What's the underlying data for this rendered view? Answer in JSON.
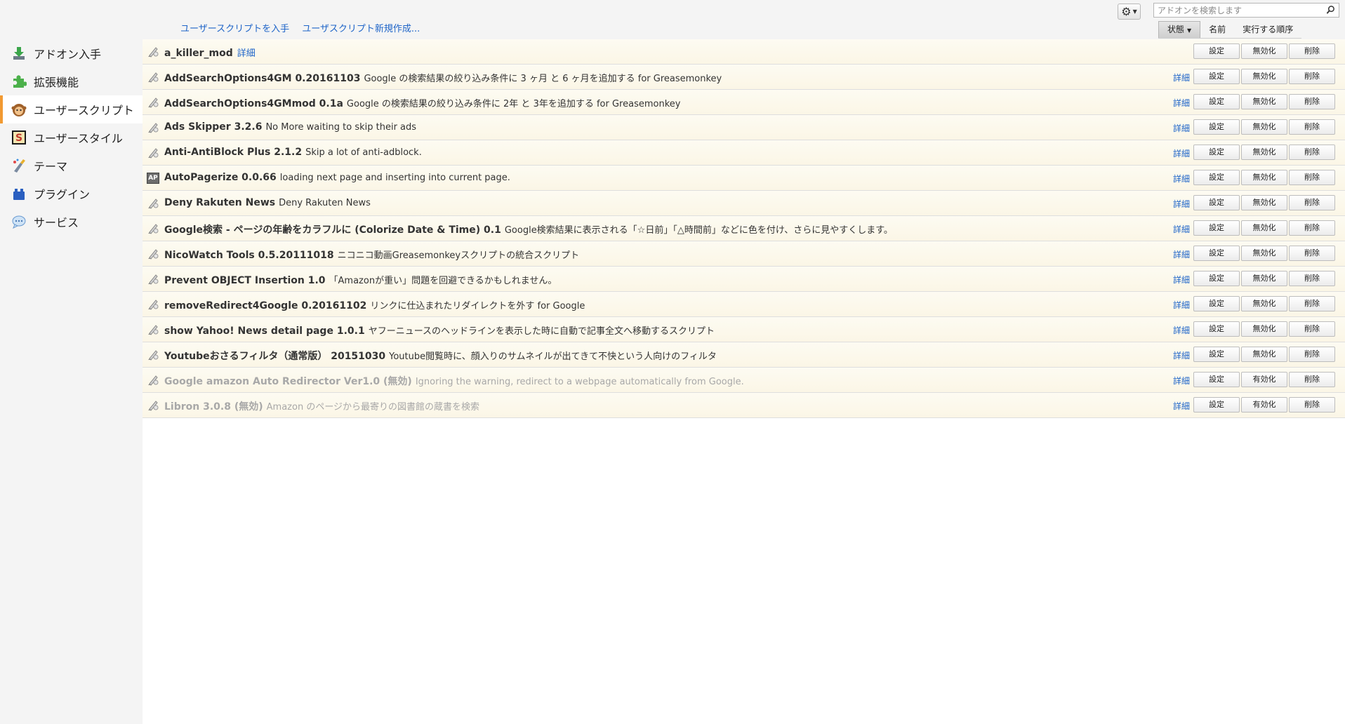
{
  "top_links": [
    "ユーザースクリプトを入手",
    "ユーザスクリプト新規作成..."
  ],
  "search": {
    "placeholder": "アドオンを検索します"
  },
  "sort": {
    "items": [
      "状態",
      "名前",
      "実行する順序"
    ]
  },
  "sidebar": {
    "items": [
      {
        "label": "アドオン入手",
        "icon": "download-icon"
      },
      {
        "label": "拡張機能",
        "icon": "puzzle-icon"
      },
      {
        "label": "ユーザースクリプト",
        "icon": "greasemonkey-icon"
      },
      {
        "label": "ユーザースタイル",
        "icon": "stylish-icon"
      },
      {
        "label": "テーマ",
        "icon": "theme-brush-icon"
      },
      {
        "label": "プラグイン",
        "icon": "plugin-blocks-icon"
      },
      {
        "label": "サービス",
        "icon": "chat-bubble-icon"
      }
    ],
    "selected_index": 2
  },
  "buttons": {
    "settings": "設定",
    "disable": "無効化",
    "enable": "有効化",
    "remove": "削除",
    "detail": "詳細"
  },
  "scripts": [
    {
      "name": "a_killer_mod",
      "description": "",
      "icon": "script-icon",
      "disabled": false
    },
    {
      "name": "AddSearchOptions4GM 0.20161103",
      "description": "Google の検索結果の絞り込み条件に 3 ヶ月 と 6 ヶ月を追加する for Greasemonkey",
      "icon": "script-icon",
      "disabled": false
    },
    {
      "name": "AddSearchOptions4GMmod 0.1a",
      "description": "Google の検索結果の絞り込み条件に 2年 と 3年を追加する for Greasemonkey",
      "icon": "script-icon",
      "disabled": false
    },
    {
      "name": "Ads Skipper 3.2.6",
      "description": "No More waiting to skip their ads",
      "icon": "script-icon",
      "disabled": false
    },
    {
      "name": "Anti-AntiBlock Plus 2.1.2",
      "description": "Skip a lot of anti-adblock.",
      "icon": "script-icon",
      "disabled": false
    },
    {
      "name": "AutoPagerize 0.0.66",
      "description": "loading next page and inserting into current page.",
      "icon": "autopagerize-icon",
      "disabled": false
    },
    {
      "name": "Deny Rakuten News",
      "description": "Deny Rakuten News",
      "icon": "script-icon",
      "disabled": false
    },
    {
      "name": "Google検索 - ページの年齢をカラフルに (Colorize Date & Time) 0.1",
      "description": "Google検索結果に表示される「☆日前」「△時間前」などに色を付け、さらに見やすくします。",
      "icon": "script-icon",
      "disabled": false
    },
    {
      "name": "NicoWatch Tools 0.5.20111018",
      "description": "ニコニコ動画Greasemonkeyスクリプトの統合スクリプト",
      "icon": "script-icon",
      "disabled": false
    },
    {
      "name": "Prevent OBJECT Insertion 1.0",
      "description": "「Amazonが重い」問題を回避できるかもしれません。",
      "icon": "script-icon",
      "disabled": false
    },
    {
      "name": "removeRedirect4Google 0.20161102",
      "description": "リンクに仕込まれたリダイレクトを外す for Google",
      "icon": "script-icon",
      "disabled": false
    },
    {
      "name": "show Yahoo! News detail page 1.0.1",
      "description": "ヤフーニュースのヘッドラインを表示した時に自動で記事全文へ移動するスクリプト",
      "icon": "script-icon",
      "disabled": false
    },
    {
      "name": "Youtubeおさるフィルタ（通常版） 20151030",
      "description": "Youtube閲覧時に、顔入りのサムネイルが出てきて不快という人向けのフィルタ",
      "icon": "script-icon",
      "disabled": false
    },
    {
      "name": "Google amazon Auto Redirector Ver1.0 (無効)",
      "description": "Ignoring the warning, redirect to a webpage automatically from Google.",
      "icon": "script-icon",
      "disabled": true
    },
    {
      "name": "Libron 3.0.8 (無効)",
      "description": "Amazon のページから最寄りの図書館の蔵書を検索",
      "icon": "script-icon",
      "disabled": true
    }
  ],
  "colors": {
    "link": "#1e64c8",
    "accent_selected": "#f29a32",
    "disabled_text": "#a8a8a8",
    "row_background": "#fbf6e6"
  }
}
